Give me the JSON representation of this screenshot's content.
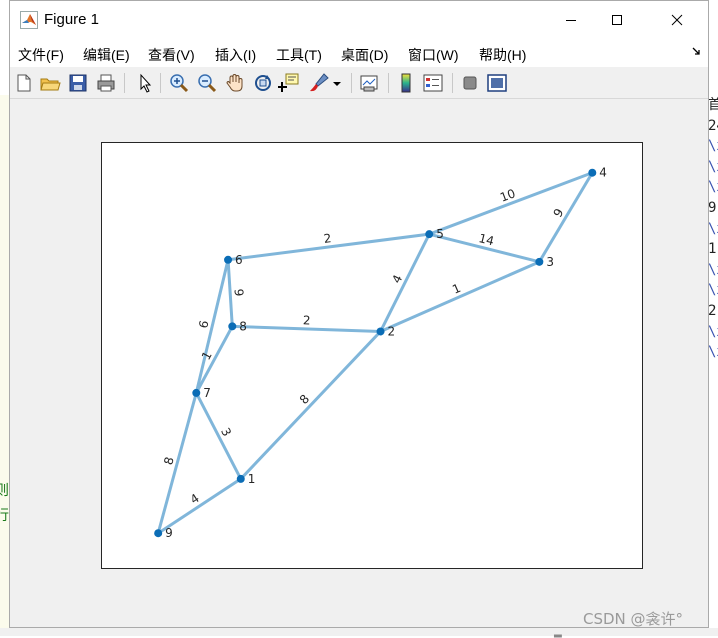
{
  "window": {
    "title": "Figure 1",
    "icon": "matlab-logo-icon",
    "controls": [
      "minimize-icon",
      "maximize-icon",
      "close-icon"
    ]
  },
  "menu": {
    "items": [
      "文件(F)",
      "编辑(E)",
      "查看(V)",
      "插入(I)",
      "工具(T)",
      "桌面(D)",
      "窗口(W)",
      "帮助(H)"
    ],
    "overflow_icon": "dock-arrow-icon"
  },
  "toolbar": {
    "buttons": [
      "new-figure-icon",
      "open-file-icon",
      "save-figure-icon",
      "print-figure-icon",
      "edit-plot-icon",
      "zoom-in-icon",
      "zoom-out-icon",
      "pan-icon",
      "rotate-3d-icon",
      "data-cursor-icon",
      "brush-icon",
      "link-plot-icon",
      "colorbar-icon",
      "legend-icon",
      "hide-plot-tools-icon",
      "show-plot-tools-icon"
    ]
  },
  "background": {
    "right_fragments": [
      "首",
      "24",
      "\\x",
      "\\x",
      "\\x",
      "9",
      "\\x",
      "1",
      "\\x",
      "\\x",
      "2",
      "\\x",
      "\\x"
    ],
    "left_fragments": [
      "则",
      "行"
    ]
  },
  "chart_data": {
    "type": "graph",
    "nodes": [
      {
        "id": "1",
        "x": 0.66,
        "y": -2.44
      },
      {
        "id": "2",
        "x": 1.32,
        "y": -1.0
      },
      {
        "id": "3",
        "x": 2.07,
        "y": -0.32
      },
      {
        "id": "4",
        "x": 2.32,
        "y": 0.55
      },
      {
        "id": "5",
        "x": 1.55,
        "y": -0.05
      },
      {
        "id": "6",
        "x": 0.6,
        "y": -0.3
      },
      {
        "id": "7",
        "x": 0.45,
        "y": -1.6
      },
      {
        "id": "8",
        "x": 0.62,
        "y": -0.95
      },
      {
        "id": "9",
        "x": 0.27,
        "y": -2.97
      }
    ],
    "edges": [
      {
        "source": "5",
        "target": "4",
        "weight": "10"
      },
      {
        "source": "4",
        "target": "3",
        "weight": "9"
      },
      {
        "source": "5",
        "target": "3",
        "weight": "14"
      },
      {
        "source": "6",
        "target": "5",
        "weight": "2"
      },
      {
        "source": "5",
        "target": "2",
        "weight": "4"
      },
      {
        "source": "2",
        "target": "3",
        "weight": "1"
      },
      {
        "source": "6",
        "target": "8",
        "weight": "9"
      },
      {
        "source": "8",
        "target": "2",
        "weight": "2"
      },
      {
        "source": "6",
        "target": "7",
        "weight": "6"
      },
      {
        "source": "7",
        "target": "8",
        "weight": "1"
      },
      {
        "source": "7",
        "target": "1",
        "weight": "3"
      },
      {
        "source": "1",
        "target": "2",
        "weight": "8"
      },
      {
        "source": "7",
        "target": "9",
        "weight": "8"
      },
      {
        "source": "9",
        "target": "1",
        "weight": "4"
      }
    ],
    "xlim": [
      0,
      2.55
    ],
    "ylim": [
      -3.3,
      0.85
    ],
    "colors": {
      "edge": "#80b6da",
      "node": "#0b6db6"
    },
    "grid": false
  },
  "watermark": "CSDN @衾许°"
}
